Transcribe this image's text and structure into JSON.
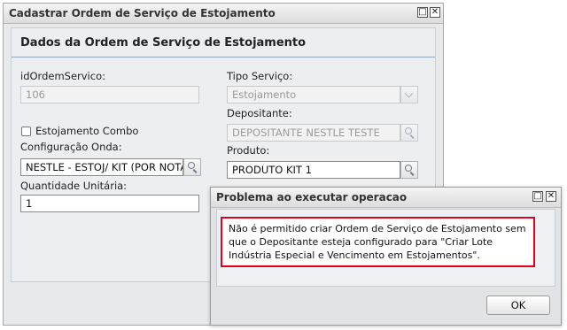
{
  "window": {
    "title": "Cadastrar Ordem de Serviço de Estojamento",
    "maximize_glyph": "□",
    "close_glyph": "✕"
  },
  "panel": {
    "title": "Dados da Ordem de Serviço de Estojamento"
  },
  "form": {
    "id_label": "idOrdemServico:",
    "id_value": "106",
    "combo_label": "Estojamento Combo",
    "combo_checked": false,
    "config_label": "Configuração Onda:",
    "config_value": "NESTLE - ESTOJ/ KIT (POR NOTA",
    "qty_label": "Quantidade Unitária:",
    "qty_value": "1",
    "tipo_label": "Tipo Serviço:",
    "tipo_value": "Estojamento",
    "depositante_label": "Depositante:",
    "depositante_value": "DEPOSITANTE NESTLE TESTE",
    "produto_label": "Produto:",
    "produto_value": "PRODUTO KIT 1"
  },
  "dialog": {
    "title": "Problema ao executar operacao",
    "message": "Não é permitido criar Ordem de Serviço de Estojamento sem que o Depositante esteja configurado para \"Criar Lote Indústria Especial e Vencimento em Estojamentos\".",
    "ok_label": "OK",
    "highlight_color": "#e2001a"
  },
  "icons": {
    "search": "search-icon",
    "dropdown": "chevron-down-icon",
    "maximize": "maximize-icon",
    "close": "close-icon"
  }
}
